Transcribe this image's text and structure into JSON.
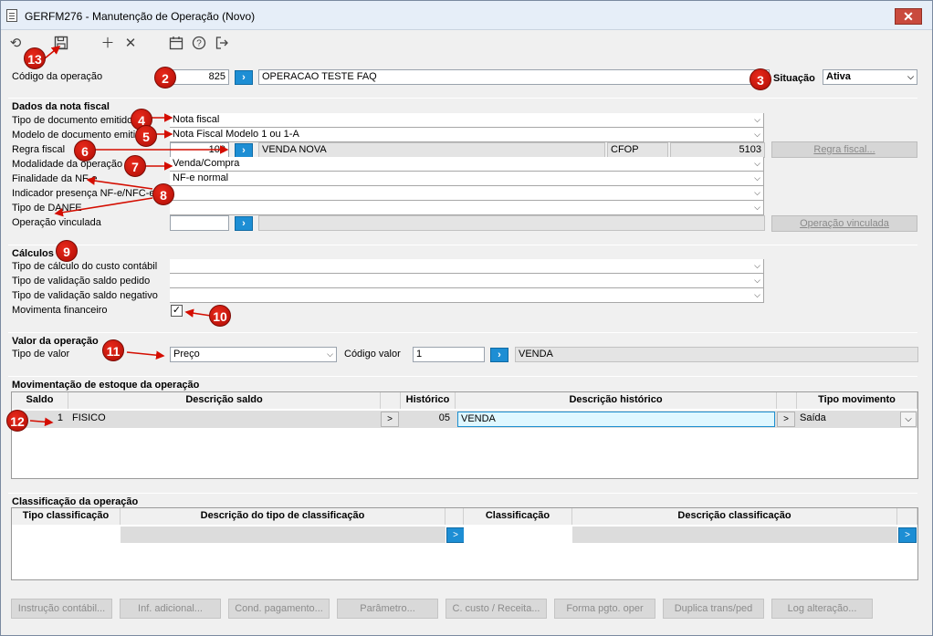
{
  "window": {
    "title": "GERFM276 - Manutenção de Operação (Novo)",
    "close_label": "✕"
  },
  "toolbar": {
    "refresh_icon": "undo-icon",
    "save_icon": "save-icon",
    "add_icon": "plus-icon",
    "delete_icon": "x-icon",
    "calendar_icon": "calendar-icon",
    "help_icon": "help-icon",
    "exit_icon": "exit-icon"
  },
  "header": {
    "codigo_label": "Código da operação",
    "codigo_value": "825",
    "descricao_value": "OPERACAO TESTE FAQ",
    "situacao_label": "Situação",
    "situacao_value": "Ativa"
  },
  "nota_fiscal": {
    "section_title": "Dados da nota fiscal",
    "tipo_documento_label": "Tipo de documento emitido",
    "tipo_documento_value": "Nota fiscal",
    "modelo_documento_label": "Modelo de documento emitido",
    "modelo_documento_value": "Nota Fiscal Modelo 1 ou 1-A",
    "regra_fiscal_label": "Regra fiscal",
    "regra_fiscal_code": "100",
    "regra_fiscal_desc": "VENDA NOVA",
    "cfop_label": "CFOP",
    "cfop_value": "5103",
    "regra_fiscal_button": "Regra fiscal...",
    "modalidade_label": "Modalidade da operação",
    "modalidade_value": "Venda/Compra",
    "finalidade_label": "Finalidade da NF-e",
    "finalidade_value": "NF-e normal",
    "indicador_label": "Indicador presença NF-e/NFC-e",
    "indicador_value": "",
    "danfe_label": "Tipo de DANFE",
    "danfe_value": "",
    "vinculada_label": "Operação vinculada",
    "vinculada_code": "",
    "vinculada_desc": "",
    "vinculada_button": "Operação vinculada"
  },
  "calculos": {
    "section_title": "Cálculos",
    "custo_label": "Tipo de cálculo do custo contábil",
    "saldo_pedido_label": "Tipo de validação saldo pedido",
    "saldo_negativo_label": "Tipo de validação saldo negativo",
    "movimenta_label": "Movimenta financeiro",
    "movimenta_checked": "✓"
  },
  "valor": {
    "section_title": "Valor da operação",
    "tipo_valor_label": "Tipo de valor",
    "tipo_valor_value": "Preço",
    "codigo_valor_label": "Código valor",
    "codigo_valor_value": "1",
    "codigo_valor_desc": "VENDA"
  },
  "estoque": {
    "section_title": "Movimentação de estoque da operação",
    "columns": [
      "Saldo",
      "Descrição saldo",
      "Histórico",
      "Descrição histórico",
      "Tipo movimento"
    ],
    "rows": [
      {
        "saldo": "1",
        "descricao_saldo": "FISICO",
        "historico": "05",
        "descricao_historico": "VENDA",
        "tipo_movimento": "Saída"
      }
    ],
    "lookup_label": ">"
  },
  "classificacao": {
    "section_title": "Classificação da operação",
    "columns": [
      "Tipo classificação",
      "Descrição do tipo de classificação",
      "Classificação",
      "Descrição classificação"
    ],
    "lookup_label": ">"
  },
  "bottom_buttons": [
    "Instrução contábil...",
    "Inf. adicional...",
    "Cond. pagamento...",
    "Parâmetro...",
    "C. custo / Receita...",
    "Forma pgto. oper",
    "Duplica trans/ped",
    "Log alteração..."
  ],
  "annotations": [
    "13",
    "2",
    "3",
    "4",
    "5",
    "6",
    "7",
    "8",
    "9",
    "10",
    "11",
    "12"
  ],
  "colors": {
    "accent": "#1d8ed4",
    "badge": "#c8140a",
    "close": "#c94a3d"
  }
}
